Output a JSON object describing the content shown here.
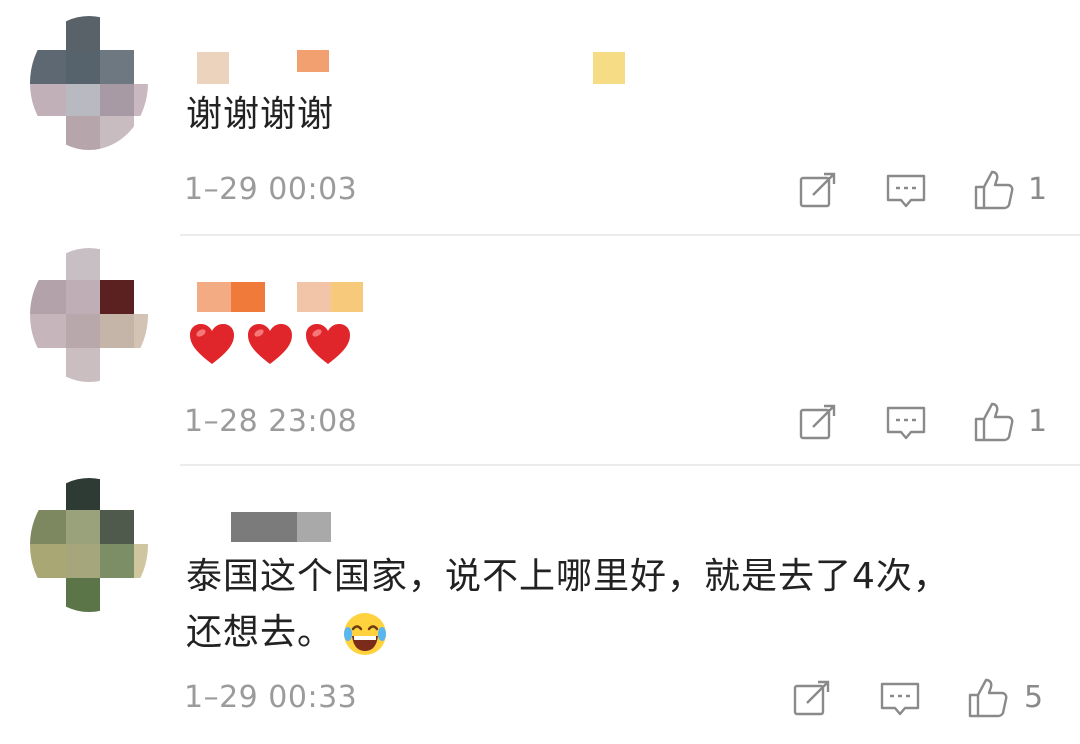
{
  "comments": [
    {
      "text": "谢谢谢谢",
      "timestamp": "1–29 00:03",
      "likes": "1"
    },
    {
      "text": "",
      "emojis": [
        "heart-icon",
        "heart-icon",
        "heart-icon"
      ],
      "timestamp": "1–28 23:08",
      "likes": "1"
    },
    {
      "text_line1": "泰国这个国家，说不上哪里好，就是去了4次，",
      "text_line2": "还想去。",
      "emoji": "laughing-tears-icon",
      "timestamp": "1–29 00:33",
      "likes": "5"
    }
  ],
  "colors": {
    "text": "#222222",
    "meta": "#9b9b9b",
    "icon": "#8a8a8a",
    "heart": "#e0262a",
    "divider": "#ececec"
  }
}
